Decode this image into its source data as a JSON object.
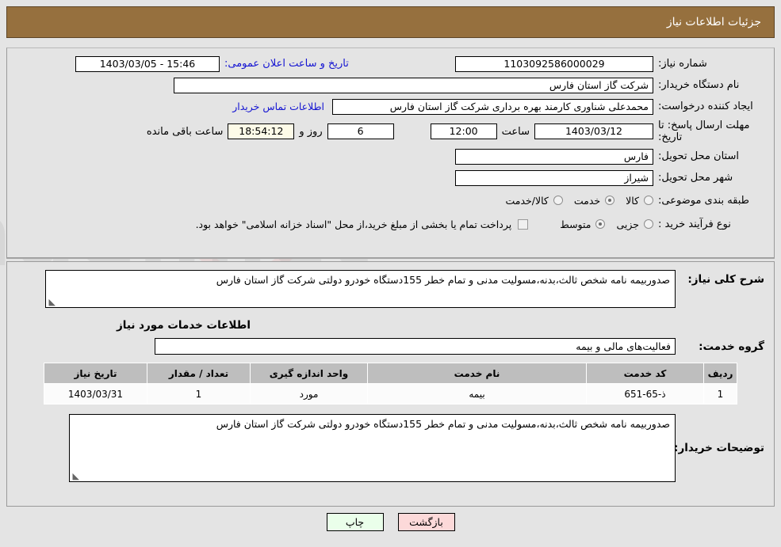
{
  "header": {
    "title": "جزئیات اطلاعات نیاز"
  },
  "form": {
    "need_number": {
      "label": "شماره نیاز:",
      "value": "1103092586000029"
    },
    "announce_datetime": {
      "label": "تاریخ و ساعت اعلان عمومی:",
      "value": "15:46 - 1403/03/05"
    },
    "buyer_org": {
      "label": "نام دستگاه خریدار:",
      "value": "شرکت گاز استان فارس"
    },
    "requester": {
      "label": "ایجاد کننده درخواست:",
      "value": "محمدعلی شناوری کارمند بهره برداری شرکت گاز استان فارس"
    },
    "buyer_contact_link": "اطلاعات تماس خریدار",
    "deadline": {
      "label": "مهلت ارسال پاسخ: تا تاریخ:",
      "date": "1403/03/12",
      "hour_label": "ساعت",
      "hour": "12:00",
      "days": "6",
      "days_label": "روز و",
      "timer": "18:54:12",
      "remaining_label": "ساعت باقی مانده"
    },
    "delivery_province": {
      "label": "استان محل تحویل:",
      "value": "فارس"
    },
    "delivery_city": {
      "label": "شهر محل تحویل:",
      "value": "شیراز"
    },
    "category": {
      "label": "طبقه بندی موضوعی:",
      "options": [
        "کالا",
        "خدمت",
        "کالا/خدمت"
      ],
      "selected": "خدمت"
    },
    "purchase_type": {
      "label": "نوع فرآیند خرید :",
      "options": [
        "جزیی",
        "متوسط"
      ],
      "selected": "متوسط",
      "checkbox_note": "پرداخت تمام یا بخشی از مبلغ خرید،از محل \"اسناد خزانه اسلامی\" خواهد بود.",
      "checkbox_checked": false
    }
  },
  "main": {
    "general_desc": {
      "label": "شرح کلی نیاز:",
      "value": "صدوربیمه نامه شخص ثالث،بدنه،مسولیت مدنی و تمام خطر 155دستگاه خودرو دولتی شرکت گاز استان فارس"
    },
    "services_section_title": "اطلاعات خدمات مورد نیاز",
    "service_group": {
      "label": "گروه خدمت:",
      "value": "فعالیت‌های مالی و بیمه"
    },
    "table": {
      "columns": [
        "ردیف",
        "کد خدمت",
        "نام خدمت",
        "واحد اندازه گیری",
        "تعداد / مقدار",
        "تاریخ نیاز"
      ],
      "rows": [
        [
          "1",
          "ذ-65-651",
          "بیمه",
          "مورد",
          "1",
          "1403/03/31"
        ]
      ]
    },
    "buyer_notes": {
      "label": "توضیحات خریدار:",
      "value": "صدوربیمه نامه شخص ثالث،بدنه،مسولیت مدنی و تمام خطر 155دستگاه خودرو دولتی شرکت گاز استان فارس"
    }
  },
  "buttons": {
    "print": "چاپ",
    "back": "بازگشت"
  },
  "colors": {
    "header_bg": "#96703e",
    "page_bg": "#e4e4e4",
    "link_blue": "#1414d2",
    "table_header_bg": "#bebebe",
    "print_btn_bg": "#eaffea",
    "back_btn_bg": "#fcd9d9",
    "timer_bg": "#fdfbe8"
  },
  "watermark": {
    "text": "AriaTender.net"
  }
}
